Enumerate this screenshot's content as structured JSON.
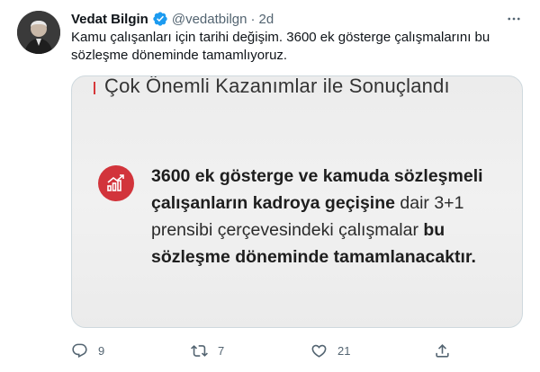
{
  "tweet": {
    "author_name": "Vedat Bilgin",
    "handle": "@vedatbilgn",
    "separator": "·",
    "time": "2d",
    "text": "Kamu çalışanları için tarihi değişim. 3600 ek gösterge çalışmalarını bu sözleşme döneminde tamamlıyoruz."
  },
  "media": {
    "heading": "Çok Önemli Kazanımlar ile Sonuçlandı",
    "body": {
      "part1_bold": "3600 ek gösterge ve kamuda sözleşmeli çalışanların kadroya geçişine",
      "part2": " dair 3+1 prensibi çerçevesindeki çalışmalar ",
      "part3_bold": "bu sözleşme döneminde tamamlanacaktır."
    },
    "accent_color": "#d2343b"
  },
  "actions": {
    "reply_count": "9",
    "retweet_count": "7",
    "like_count": "21"
  },
  "icons": {
    "verified": "verified-badge-icon",
    "more": "more-options-icon",
    "chart": "chart-growth-icon",
    "reply": "reply-icon",
    "retweet": "retweet-icon",
    "like": "like-icon",
    "share": "share-icon"
  },
  "colors": {
    "verified_blue": "#1d9bf0",
    "secondary_text": "#536471",
    "border": "#cfd9de"
  }
}
